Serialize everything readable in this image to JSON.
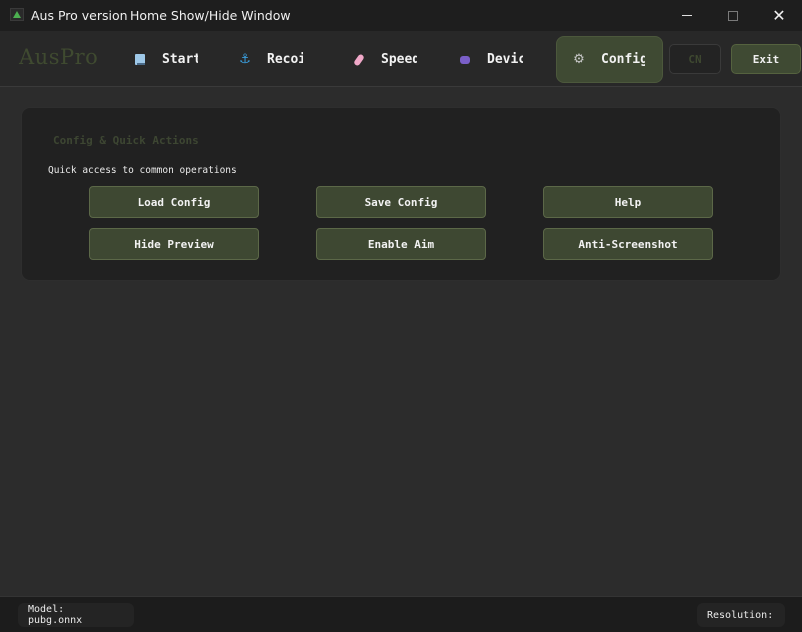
{
  "window": {
    "title": "Aus Pro version",
    "extra": "Home Show/Hide Window"
  },
  "nav": {
    "brand": "AusPro",
    "tabs": [
      {
        "label": "Start",
        "icon": "monitor-icon"
      },
      {
        "label": "Recoil",
        "icon": "anchor-icon"
      },
      {
        "label": "Speed",
        "icon": "rocket-icon"
      },
      {
        "label": "Device",
        "icon": "gamepad-icon"
      },
      {
        "label": "Config",
        "icon": "gear-icon"
      }
    ],
    "active_tab": "Config",
    "lang_label": "CN",
    "exit_label": "Exit"
  },
  "panel": {
    "title": "Config & Quick Actions",
    "subtitle": "Quick access to common operations",
    "actions": [
      "Load Config",
      "Save Config",
      "Help",
      "Hide Preview",
      "Enable Aim",
      "Anti-Screenshot"
    ]
  },
  "status": {
    "model": "Model: pubg.onnx",
    "resolution": "Resolution:"
  },
  "colors": {
    "accent": "#3f4a33",
    "accent_border": "#5c6848",
    "muted_text": "#3d4632",
    "background": "#2c2c2c",
    "titlebar": "#1e1e1e"
  }
}
